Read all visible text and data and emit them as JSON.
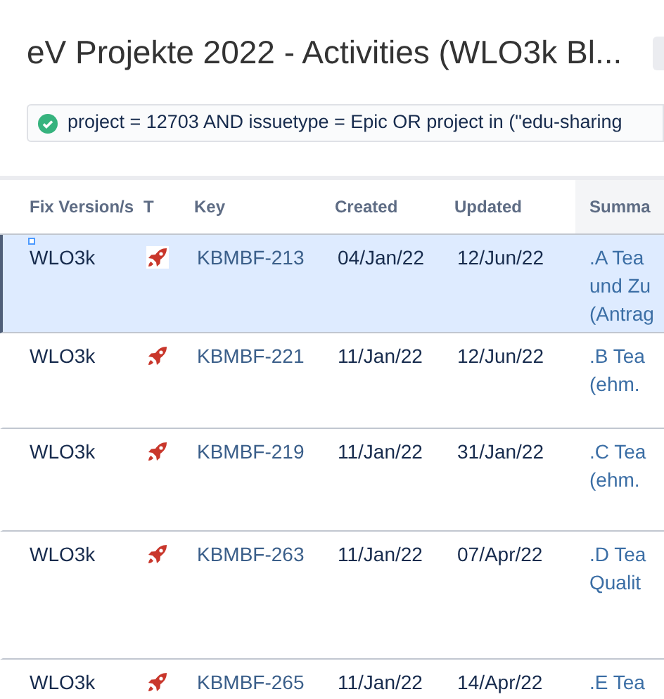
{
  "title": "eV Projekte 2022 - Activities (WLO3k Bl...",
  "query": {
    "valid": true,
    "text": "project = 12703 AND issuetype = Epic OR project in (\"edu-sharing"
  },
  "table": {
    "columns": [
      "Fix Version/s",
      "T",
      "Key",
      "Created",
      "Updated",
      "Summa"
    ],
    "rows": [
      {
        "selected": true,
        "fix_version": "WLO3k",
        "kind": "epic",
        "key": "KBMBF-213",
        "created": "04/Jan/22",
        "updated": "12/Jun/22",
        "summary_lines": [
          ".A Tea",
          "und Zu",
          "(Antrag"
        ]
      },
      {
        "selected": false,
        "fix_version": "WLO3k",
        "kind": "epic",
        "key": "KBMBF-221",
        "created": "11/Jan/22",
        "updated": "12/Jun/22",
        "summary_lines": [
          ".B Tea",
          "(ehm."
        ]
      },
      {
        "selected": false,
        "fix_version": "WLO3k",
        "kind": "epic",
        "key": "KBMBF-219",
        "created": "11/Jan/22",
        "updated": "31/Jan/22",
        "summary_lines": [
          ".C Tea",
          "(ehm."
        ]
      },
      {
        "selected": false,
        "fix_version": "WLO3k",
        "kind": "epic",
        "key": "KBMBF-263",
        "created": "11/Jan/22",
        "updated": "07/Apr/22",
        "summary_lines": [
          ".D Tea",
          "Qualit"
        ]
      },
      {
        "selected": false,
        "fix_version": "WLO3k",
        "kind": "epic",
        "key": "KBMBF-265",
        "created": "11/Jan/22",
        "updated": "14/Apr/22",
        "summary_lines": [
          ".E Tea"
        ]
      }
    ]
  }
}
